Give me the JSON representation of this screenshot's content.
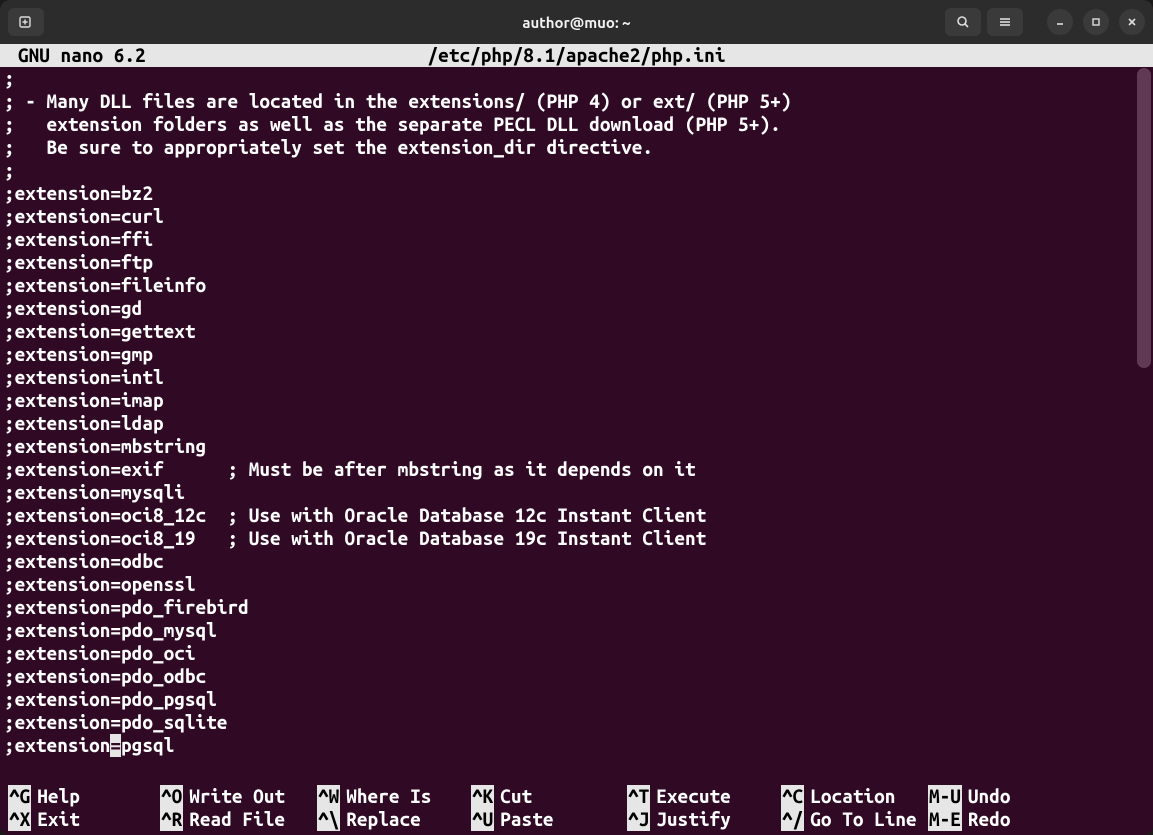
{
  "window": {
    "title": "author@muo: ~"
  },
  "nano": {
    "app_label": "GNU nano 6.2",
    "file_path": "/etc/php/8.1/apache2/php.ini"
  },
  "editor_lines": [
    ";",
    "; - Many DLL files are located in the extensions/ (PHP 4) or ext/ (PHP 5+)",
    ";   extension folders as well as the separate PECL DLL download (PHP 5+).",
    ";   Be sure to appropriately set the extension_dir directive.",
    ";",
    ";extension=bz2",
    ";extension=curl",
    ";extension=ffi",
    ";extension=ftp",
    ";extension=fileinfo",
    ";extension=gd",
    ";extension=gettext",
    ";extension=gmp",
    ";extension=intl",
    ";extension=imap",
    ";extension=ldap",
    ";extension=mbstring",
    ";extension=exif      ; Must be after mbstring as it depends on it",
    ";extension=mysqli",
    ";extension=oci8_12c  ; Use with Oracle Database 12c Instant Client",
    ";extension=oci8_19   ; Use with Oracle Database 19c Instant Client",
    ";extension=odbc",
    ";extension=openssl",
    ";extension=pdo_firebird",
    ";extension=pdo_mysql",
    ";extension=pdo_oci",
    ";extension=pdo_odbc",
    ";extension=pdo_pgsql",
    ";extension=pdo_sqlite"
  ],
  "cursor_line": {
    "before": ";extension",
    "cursor_char": "=",
    "after": "pgsql"
  },
  "footer_row1": [
    {
      "key": "^G",
      "label": "Help"
    },
    {
      "key": "^O",
      "label": "Write Out"
    },
    {
      "key": "^W",
      "label": "Where Is"
    },
    {
      "key": "^K",
      "label": "Cut"
    },
    {
      "key": "^T",
      "label": "Execute"
    },
    {
      "key": "^C",
      "label": "Location"
    },
    {
      "key": "M-U",
      "label": "Undo"
    }
  ],
  "footer_row2": [
    {
      "key": "^X",
      "label": "Exit"
    },
    {
      "key": "^R",
      "label": "Read File"
    },
    {
      "key": "^\\",
      "label": "Replace"
    },
    {
      "key": "^U",
      "label": "Paste"
    },
    {
      "key": "^J",
      "label": "Justify"
    },
    {
      "key": "^/",
      "label": "Go To Line"
    },
    {
      "key": "M-E",
      "label": "Redo"
    }
  ],
  "footer_cols": [
    0,
    152,
    309,
    463,
    619,
    773,
    920
  ]
}
